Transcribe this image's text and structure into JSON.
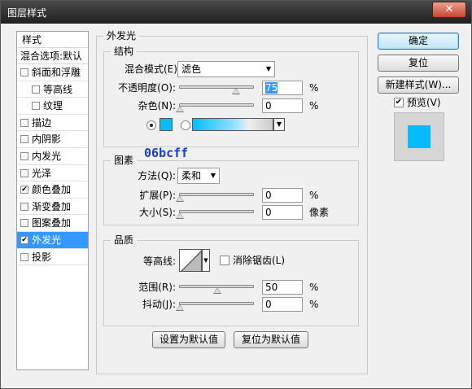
{
  "window": {
    "title": "图层样式",
    "close_label": "✕"
  },
  "left_panel": {
    "header": "样式",
    "subheader": "混合选项:默认",
    "items": [
      {
        "label": "斜面和浮雕",
        "checked": false
      },
      {
        "label": "等高线",
        "checked": false
      },
      {
        "label": "纹理",
        "checked": false
      },
      {
        "label": "描边",
        "checked": false
      },
      {
        "label": "内阴影",
        "checked": false
      },
      {
        "label": "内发光",
        "checked": false
      },
      {
        "label": "光泽",
        "checked": false
      },
      {
        "label": "颜色叠加",
        "checked": true
      },
      {
        "label": "渐变叠加",
        "checked": false
      },
      {
        "label": "图案叠加",
        "checked": false
      },
      {
        "label": "外发光",
        "checked": true
      },
      {
        "label": "投影",
        "checked": false
      }
    ]
  },
  "panel": {
    "title": "外发光",
    "structure": {
      "title": "结构",
      "blend_mode_label": "混合模式(E):",
      "blend_mode_value": "滤色",
      "opacity_label": "不透明度(O):",
      "opacity_value": "75",
      "noise_label": "杂色(N):",
      "noise_value": "0",
      "percent": "%"
    },
    "annotation": "06bcff",
    "elements": {
      "title": "图素",
      "method_label": "方法(Q):",
      "method_value": "柔和",
      "spread_label": "扩展(P):",
      "spread_value": "0",
      "size_label": "大小(S):",
      "size_value": "0",
      "percent": "%",
      "px_unit": "像素"
    },
    "quality": {
      "title": "品质",
      "contour_label": "等高线:",
      "anti_alias_label": "消除锯齿(L)",
      "range_label": "范围(R):",
      "range_value": "50",
      "jitter_label": "抖动(J):",
      "jitter_value": "0",
      "percent": "%"
    },
    "set_default_label": "设置为默认值",
    "reset_default_label": "复位为默认值"
  },
  "buttons": {
    "ok": "确定",
    "reset": "复位",
    "new_style": "新建样式(W)...",
    "preview_label": "预览(V)"
  },
  "colors": {
    "glow_color": "#06bcff",
    "selection": "#3399ff"
  }
}
